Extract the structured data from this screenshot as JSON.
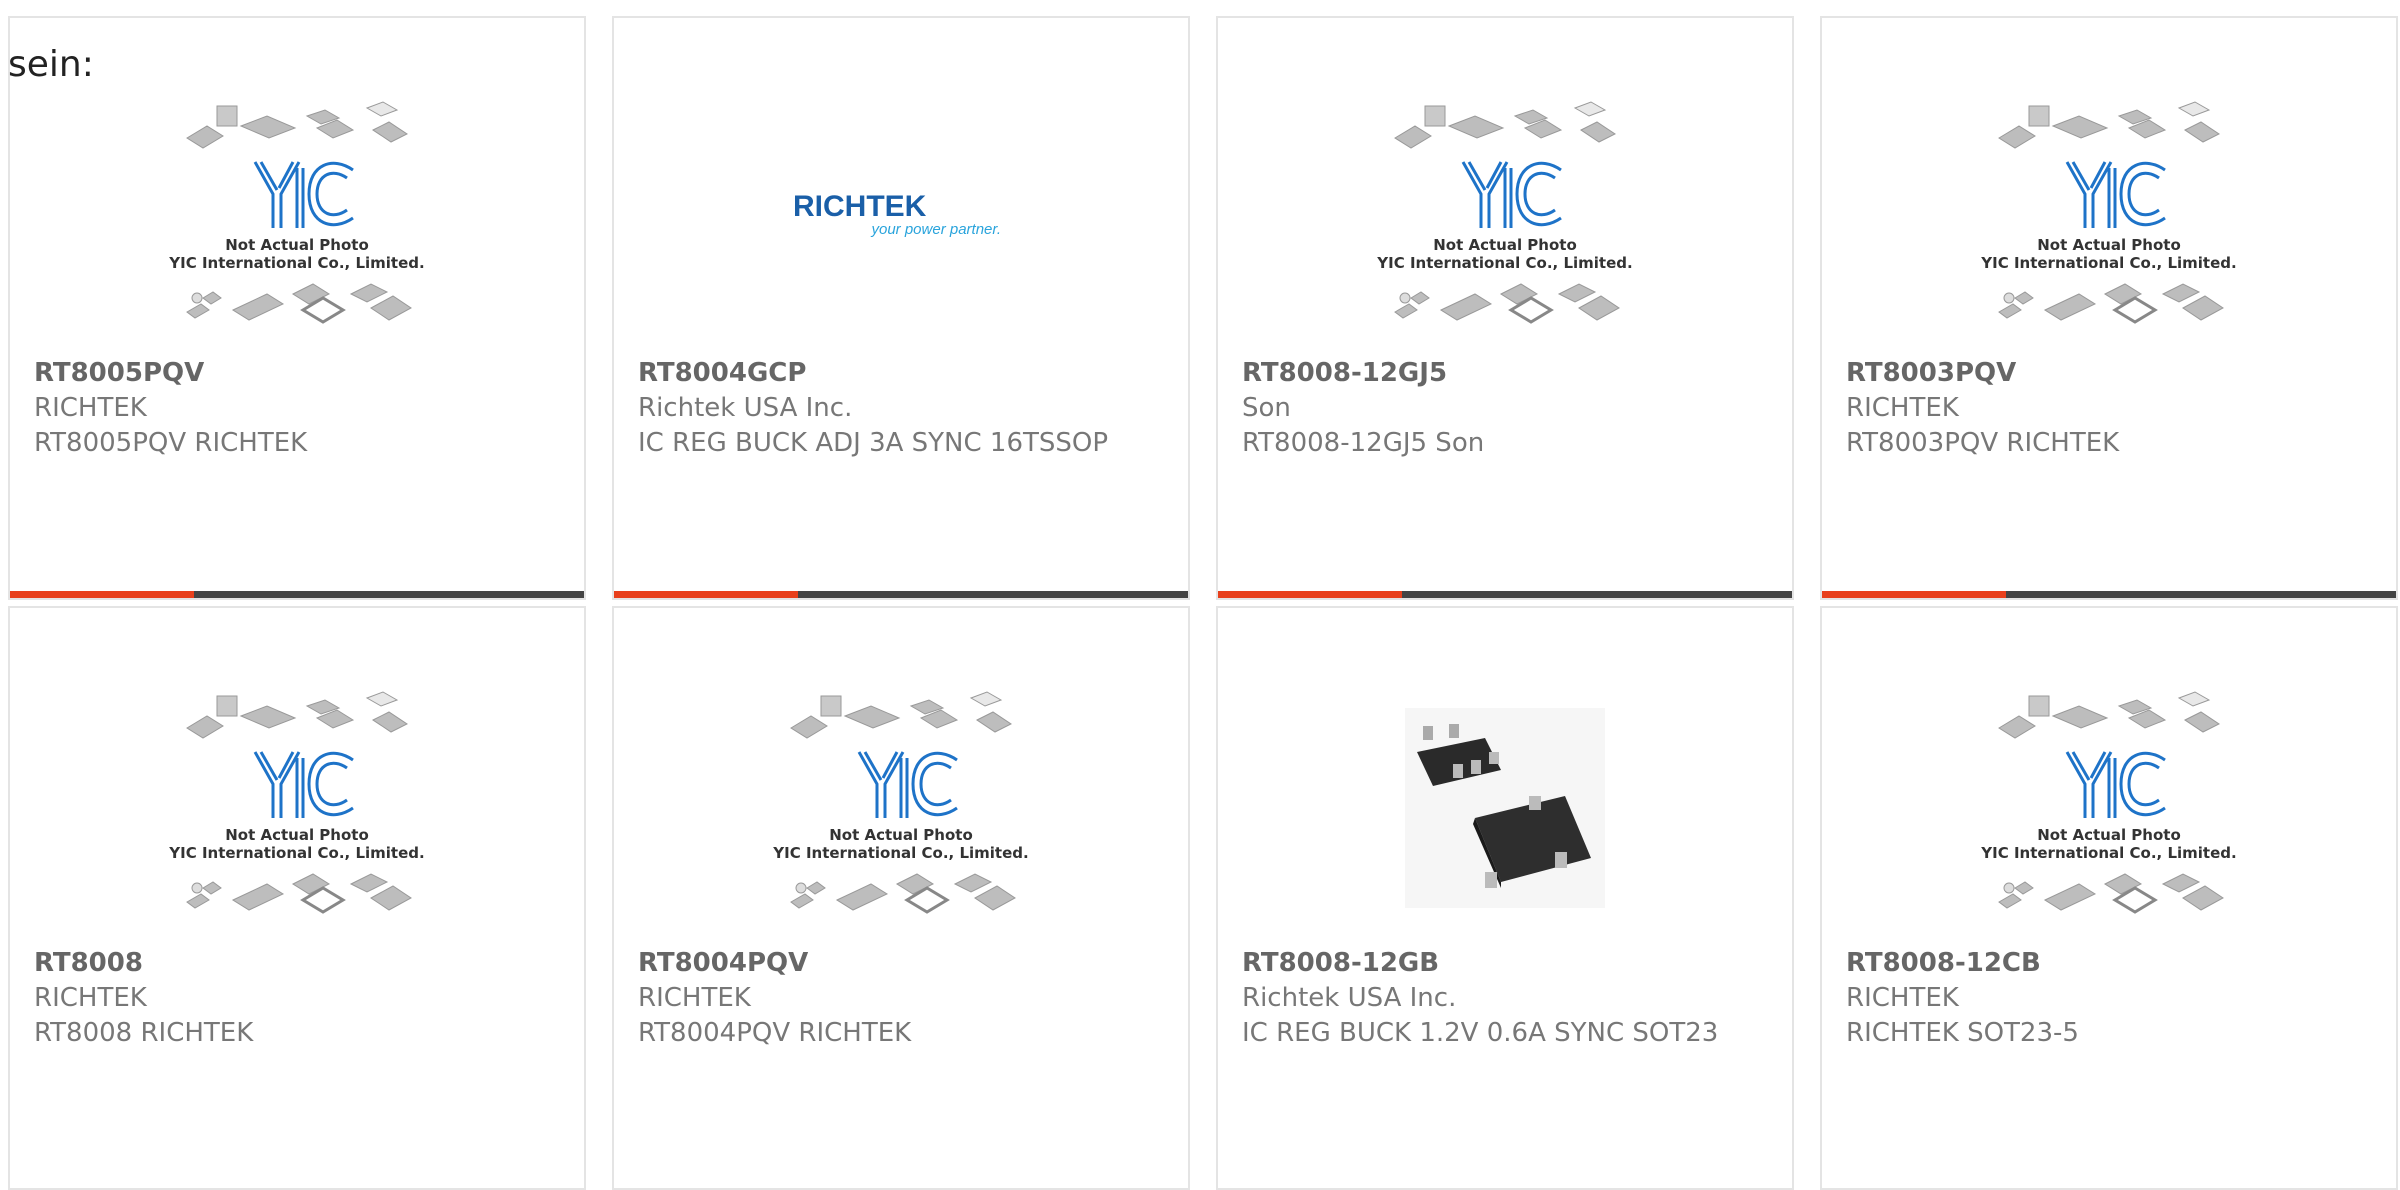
{
  "intro_text": "sein:",
  "placeholder": {
    "logo": "YIC",
    "line1": "Not Actual Photo",
    "line2": "YIC International Co., Limited."
  },
  "brand_logo": {
    "name": "RICHTEK",
    "tagline": "your power partner."
  },
  "products": [
    {
      "pn": "RT8005PQV",
      "mfr": "RICHTEK",
      "desc": "RT8005PQV RICHTEK",
      "image": "placeholder"
    },
    {
      "pn": "RT8004GCP",
      "mfr": "Richtek USA Inc.",
      "desc": "IC REG BUCK ADJ 3A SYNC 16TSSOP",
      "image": "richtek-logo"
    },
    {
      "pn": "RT8008-12GJ5",
      "mfr": "Son",
      "desc": "RT8008-12GJ5 Son",
      "image": "placeholder"
    },
    {
      "pn": "RT8003PQV",
      "mfr": "RICHTEK",
      "desc": "RT8003PQV RICHTEK",
      "image": "placeholder"
    },
    {
      "pn": "RT8008",
      "mfr": "RICHTEK",
      "desc": "RT8008 RICHTEK",
      "image": "placeholder"
    },
    {
      "pn": "RT8004PQV",
      "mfr": "RICHTEK",
      "desc": "RT8004PQV RICHTEK",
      "image": "placeholder"
    },
    {
      "pn": "RT8008-12GB",
      "mfr": "Richtek USA Inc.",
      "desc": "IC REG BUCK 1.2V 0.6A SYNC SOT23",
      "image": "sot23-photo"
    },
    {
      "pn": "RT8008-12CB",
      "mfr": "RICHTEK",
      "desc": "RICHTEK SOT23-5",
      "image": "placeholder"
    }
  ],
  "colors": {
    "accent": "#e8401c",
    "bar": "#444444",
    "logo_blue": "#1a5fa8",
    "border": "#e4e4e4"
  }
}
